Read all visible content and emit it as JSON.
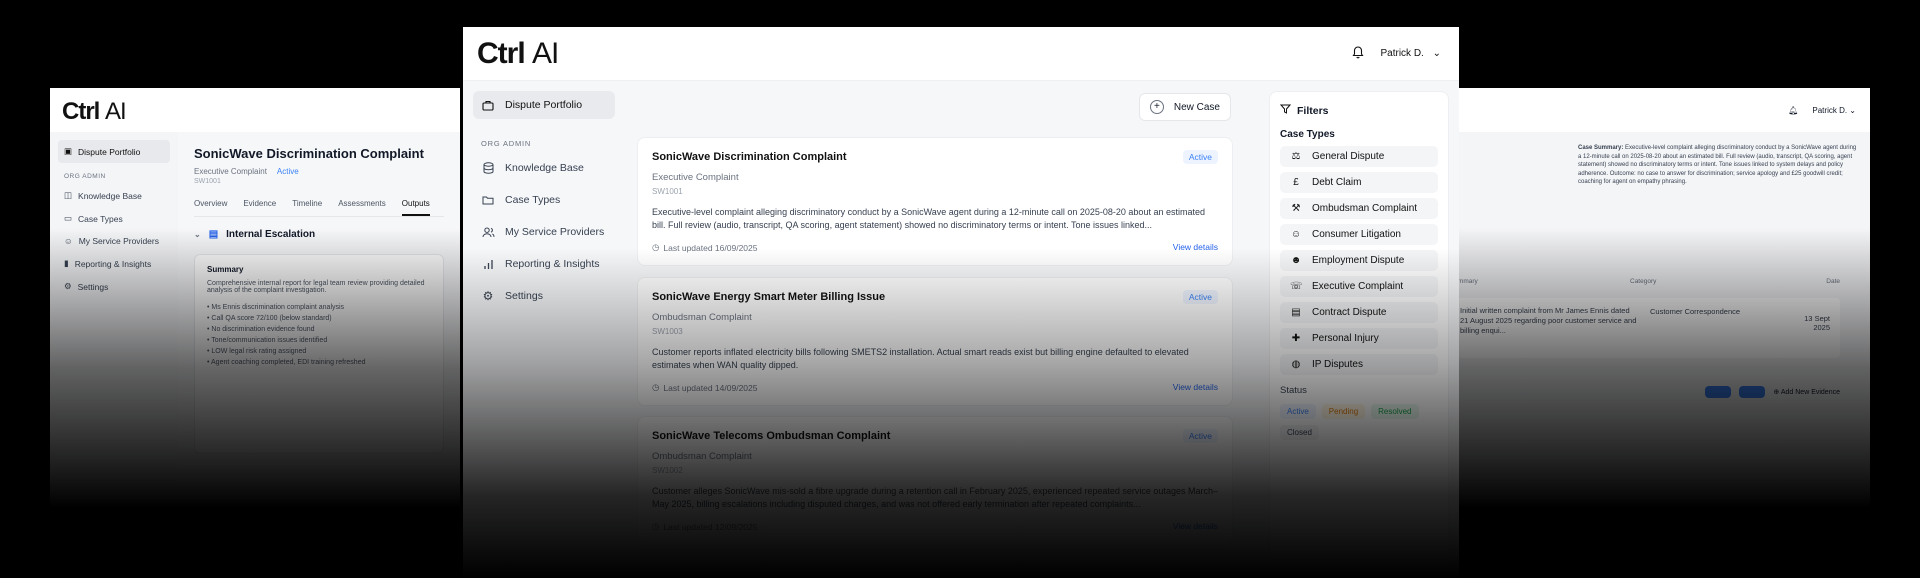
{
  "brand": {
    "name": "Ctrl",
    "suffix": "AI"
  },
  "user": {
    "name": "Patrick D."
  },
  "sidebar": {
    "top": {
      "label": "Dispute Portfolio"
    },
    "section": "ORG ADMIN",
    "items": [
      {
        "label": "Knowledge Base"
      },
      {
        "label": "Case Types"
      },
      {
        "label": "My Service Providers"
      },
      {
        "label": "Reporting & Insights"
      },
      {
        "label": "Settings"
      }
    ]
  },
  "main": {
    "new_case_label": "New Case",
    "cases": [
      {
        "title": "SonicWave Discrimination Complaint",
        "status": "Active",
        "type": "Executive Complaint",
        "code": "SW1001",
        "description": "Executive-level complaint alleging discriminatory conduct by a SonicWave agent during a 12-minute call on 2025-08-20 about an estimated bill. Full review (audio, transcript, QA scoring, agent statement) showed no discriminatory terms or intent. Tone issues linked...",
        "updated": "Last updated 16/09/2025",
        "view": "View details"
      },
      {
        "title": "SonicWave Energy Smart Meter Billing Issue",
        "status": "Active",
        "type": "Ombudsman Complaint",
        "code": "SW1003",
        "description": "Customer reports inflated electricity bills following SMETS2 installation. Actual smart reads exist but billing engine defaulted to elevated estimates when WAN quality dipped.",
        "updated": "Last updated 14/09/2025",
        "view": "View details"
      },
      {
        "title": "SonicWave Telecoms Ombudsman Complaint",
        "status": "Active",
        "type": "Ombudsman Complaint",
        "code": "SW1002",
        "description": "Customer alleges SonicWave mis-sold a fibre upgrade during a retention call in February 2025, experienced repeated service outages March–May 2025, billing escalations including disputed charges, and was not offered early termination after repeated complaints...",
        "updated": "Last updated 12/09/2025",
        "view": "View details"
      }
    ]
  },
  "filters": {
    "title": "Filters",
    "case_types_label": "Case Types",
    "case_types": [
      {
        "label": "General Dispute",
        "icon": "scale-icon"
      },
      {
        "label": "Debt Claim",
        "icon": "pound-icon"
      },
      {
        "label": "Ombudsman Complaint",
        "icon": "gavel-icon"
      },
      {
        "label": "Consumer Litigation",
        "icon": "user-scale-icon"
      },
      {
        "label": "Employment Dispute",
        "icon": "user-icon"
      },
      {
        "label": "Executive Complaint",
        "icon": "phone-icon"
      },
      {
        "label": "Contract Dispute",
        "icon": "document-icon"
      },
      {
        "label": "Personal Injury",
        "icon": "injury-icon"
      },
      {
        "label": "IP Disputes",
        "icon": "globe-icon"
      }
    ],
    "status_label": "Status",
    "statuses": [
      "Active",
      "Pending",
      "Resolved",
      "Closed"
    ]
  },
  "left_window": {
    "title": "SonicWave Discrimination Complaint",
    "type": "Executive Complaint",
    "status": "Active",
    "code": "SW1001",
    "tabs": [
      "Overview",
      "Evidence",
      "Timeline",
      "Assessments",
      "Outputs"
    ],
    "section": "Internal Escalation",
    "summary_heading": "Summary",
    "summary_text": "Comprehensive internal report for legal team review providing detailed analysis of the complaint investigation.",
    "bullets": [
      "• Ms Ennis discrimination complaint analysis",
      "• Call QA score 72/100 (below standard)",
      "• No discrimination evidence found",
      "• Tone/communication issues identified",
      "• LOW legal risk rating assigned",
      "• Agent coaching completed, EDI training refreshed"
    ]
  },
  "right_window": {
    "summary_label": "Case Summary:",
    "summary_text": "Executive-level complaint alleging discriminatory conduct by a SonicWave agent during a 12-minute call on 2025-08-20 about an estimated bill. Full review (audio, transcript, QA scoring, agent statement) showed no discriminatory terms or intent. Tone issues linked to system delays and policy adherence. Outcome: no case to answer for discrimination; service apology and £25 goodwill credit; coaching for agent on empathy phrasing.",
    "columns": [
      "Summary",
      "Category",
      "Date"
    ],
    "row": {
      "summary": "Initial written complaint from Mr James Ennis dated 21 August 2025 regarding poor customer service and billing enqui...",
      "category": "Customer Correspondence",
      "date": "13 Sept 2025"
    },
    "add_evidence": "Add New Evidence"
  },
  "colors": {
    "accent": "#3b82f6",
    "pending": "#d97706",
    "resolved": "#16a34a"
  }
}
